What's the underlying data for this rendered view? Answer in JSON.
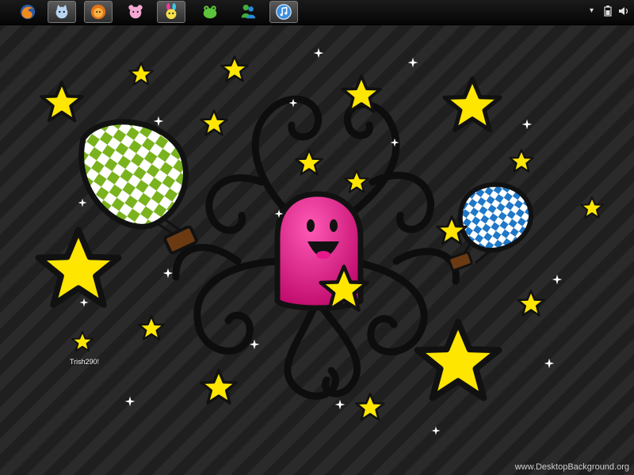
{
  "taskbar": {
    "apps": [
      {
        "name": "firefox-icon",
        "active": false
      },
      {
        "name": "cat-icon",
        "active": true
      },
      {
        "name": "lion-icon",
        "active": true
      },
      {
        "name": "bear-icon",
        "active": false
      },
      {
        "name": "bunny-icon",
        "active": true
      },
      {
        "name": "frog-icon",
        "active": false
      },
      {
        "name": "messenger-icon",
        "active": false
      },
      {
        "name": "itunes-icon",
        "active": true
      }
    ],
    "tray": {
      "arrow": "▾",
      "battery_icon": "battery-icon",
      "speaker_icon": "speaker-icon"
    }
  },
  "desktop": {
    "shortcut_label": "Trish290!",
    "watermark": "www.DesktopBackground.org"
  },
  "colors": {
    "star": "#ffe600",
    "ghost": "#e8188a",
    "balloon_green": "#7ab31e",
    "balloon_blue": "#1f78c8",
    "swirl": "#0d0d0d"
  }
}
